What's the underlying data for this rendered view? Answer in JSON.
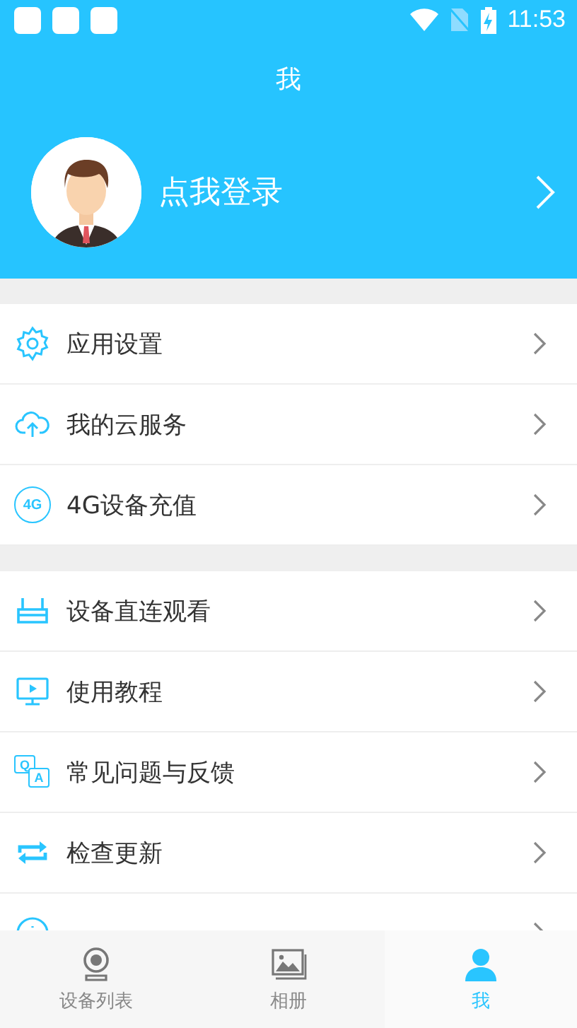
{
  "status_bar": {
    "time": "11:53"
  },
  "header": {
    "title": "我"
  },
  "profile": {
    "login_text": "点我登录"
  },
  "menu_groups": [
    {
      "items": [
        {
          "kind": "gear",
          "label": "应用设置"
        },
        {
          "kind": "cloud",
          "label": "我的云服务"
        },
        {
          "kind": "cellular",
          "label": "4G设备充值",
          "badge": "4G"
        }
      ]
    },
    {
      "items": [
        {
          "kind": "router",
          "label": "设备直连观看"
        },
        {
          "kind": "monitor",
          "label": "使用教程"
        },
        {
          "kind": "qa",
          "label": "常见问题与反馈",
          "badge_q": "Q",
          "badge_a": "A"
        },
        {
          "kind": "refresh",
          "label": "检查更新"
        },
        {
          "kind": "info"
        }
      ]
    }
  ],
  "tabs": [
    {
      "kind": "camera",
      "label": "设备列表",
      "selected": false
    },
    {
      "kind": "photo",
      "label": "相册",
      "selected": false
    },
    {
      "kind": "person",
      "label": "我",
      "selected": true
    }
  ]
}
